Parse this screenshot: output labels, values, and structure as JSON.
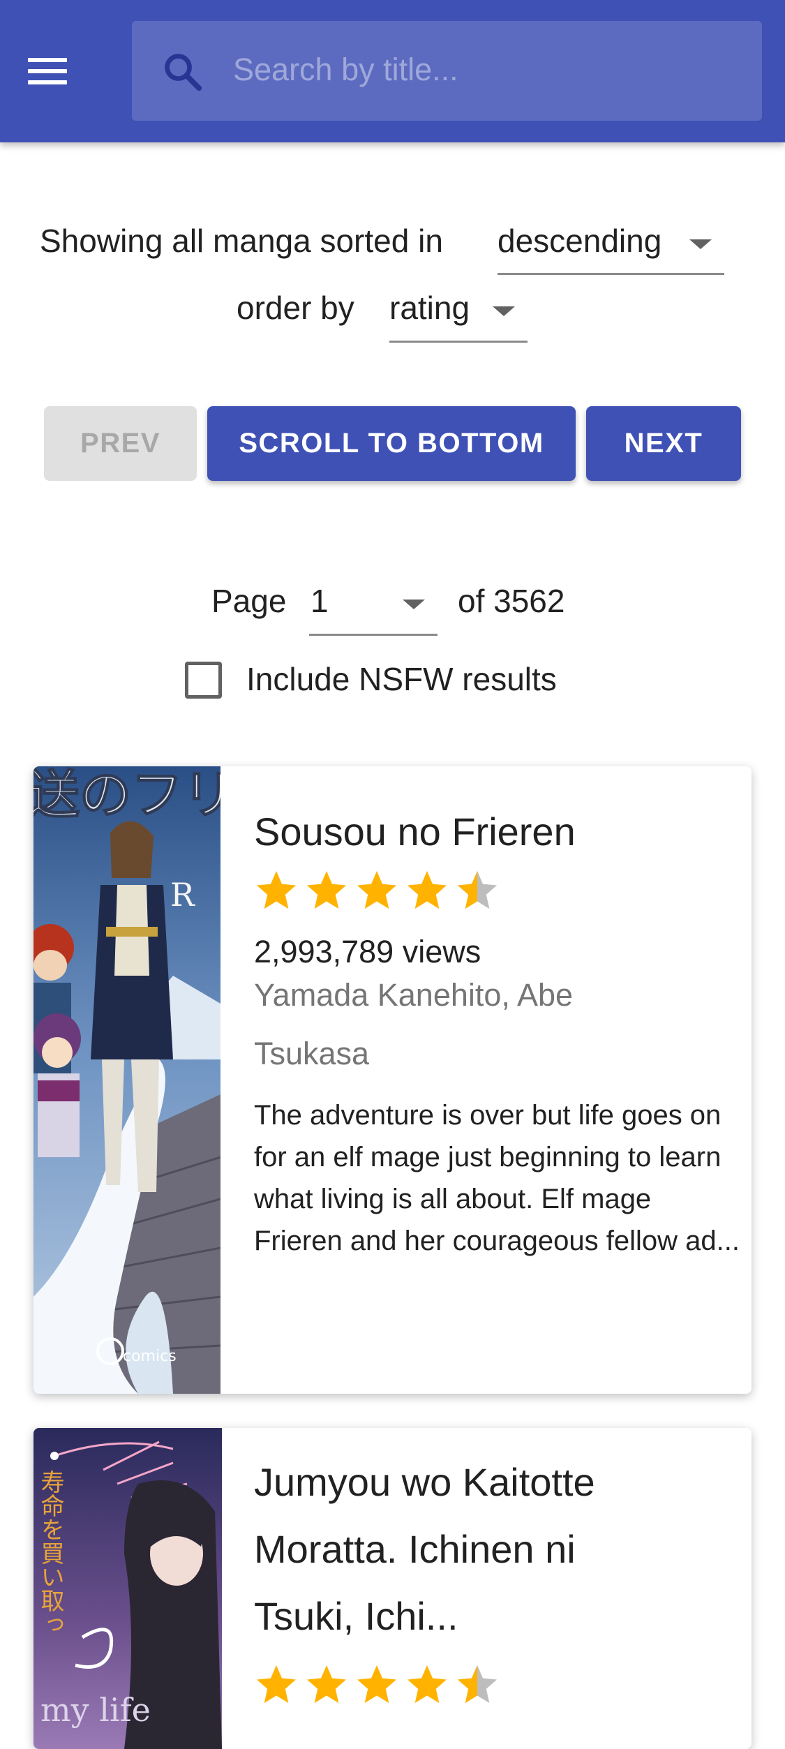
{
  "appbar": {
    "menu_icon": "menu-icon",
    "search_icon": "search-icon",
    "search_placeholder": "Search by title...",
    "color": "#3f51b5"
  },
  "sort": {
    "prefix": "Showing all manga sorted in",
    "order_value": "descending",
    "order_by_label": "order by",
    "by_value": "rating"
  },
  "buttons": {
    "prev": "PREV",
    "scroll": "SCROLL TO BOTTOM",
    "next": "NEXT"
  },
  "pagination": {
    "page_label": "Page",
    "page_value": "1",
    "total_label": "of 3562"
  },
  "nsfw": {
    "label": "Include NSFW results",
    "checked": false
  },
  "manga": [
    {
      "title": "Sousou no Frieren",
      "rating": 4.5,
      "views": "2,993,789 views",
      "authors_line1": "Yamada Kanehito, Abe",
      "authors_line2": "Tsukasa",
      "description": "The adventure is over but life goes on for an elf mage just beginning to learn what living is all about. Elf mage Frieren and her courageous fellow ad...",
      "cover_text_top": "送のフリー",
      "cover_text_r": "R",
      "cover_text_publisher": "comics"
    },
    {
      "title_line1": "Jumyou wo Kaitotte",
      "title_line2": "Moratta. Ichinen ni",
      "title_line3": "Tsuki, Ichi...",
      "rating": 4.5,
      "cover_text_vertical": "寿命を買い取っ",
      "cover_text_bottom": "my life"
    }
  ]
}
